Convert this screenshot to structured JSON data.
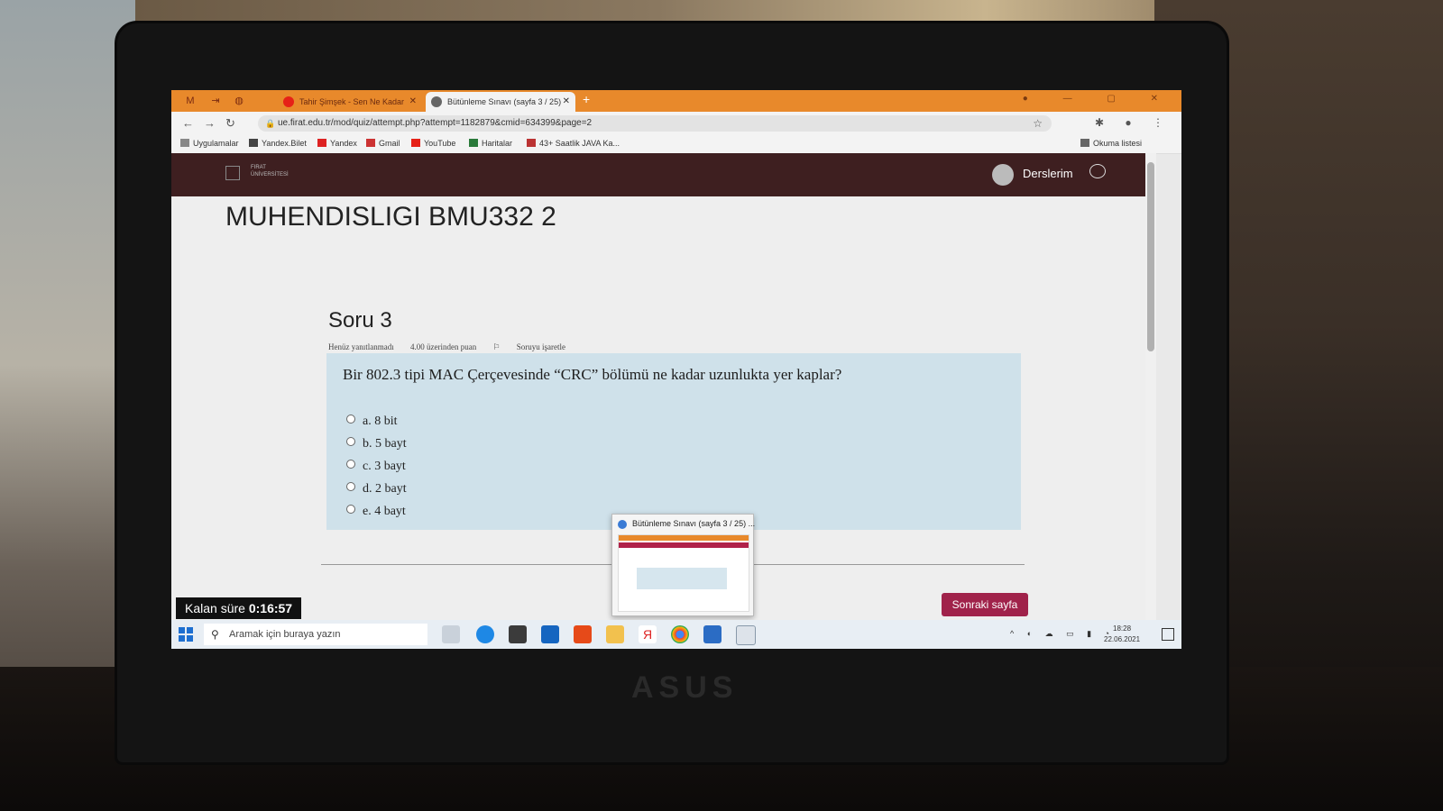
{
  "browser": {
    "tabs": [
      {
        "label": "Tahir Şimşek - Sen Ne Kadar Sev...",
        "active": false
      },
      {
        "label": "Bütünleme Sınavı (sayfa 3 / 25)",
        "active": true
      }
    ],
    "url": "ue.firat.edu.tr/mod/quiz/attempt.php?attempt=1182879&cmid=634399&page=2",
    "bookmarks": [
      "Uygulamalar",
      "Yandex.Bilet",
      "Yandex",
      "Gmail",
      "YouTube",
      "Haritalar",
      "43+ Saatlik JAVA Ka...",
      "Okuma listesi"
    ]
  },
  "site": {
    "logo_text_line1": "FIRAT",
    "logo_text_line2": "ÜNİVERSİTESİ",
    "nav_courses": "Derslerim"
  },
  "page": {
    "course_title": "MUHENDISLIGI BMU332 2"
  },
  "question": {
    "heading": "Soru 3",
    "status": "Henüz yanıtlanmadı",
    "points": "4.00 üzerinden puan",
    "flag_label": "Soruyu işaretle",
    "text": "Bir 802.3 tipi MAC Çerçevesinde “CRC” bölümü ne kadar uzunlukta yer kaplar?",
    "options": [
      "a. 8 bit",
      "b. 5 bayt",
      "c. 3 bayt",
      "d. 2 bayt",
      "e. 4 bayt"
    ]
  },
  "next_button": "Sonraki sayfa",
  "timer": {
    "label": "Kalan süre",
    "value": "0:16:57"
  },
  "thumbnail_title": "Bütünleme Sınavı (sayfa 3 / 25) ...",
  "taskbar": {
    "search_placeholder": "Aramak için buraya yazın",
    "time": "18:28",
    "date": "22.06.2021"
  }
}
